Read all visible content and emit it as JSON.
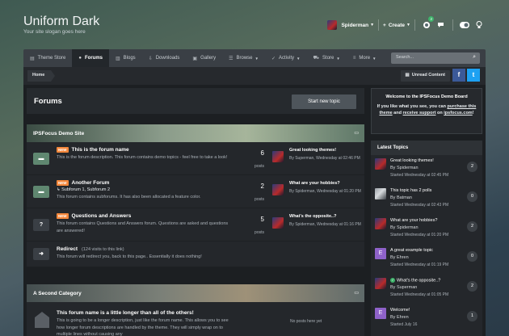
{
  "site": {
    "title": "Uniform Dark",
    "slogan": "Your site slogan goes here"
  },
  "userbar": {
    "username": "Spiderman",
    "create_label": "Create",
    "notifications_count": "2"
  },
  "nav": {
    "items": [
      {
        "label": "Theme Store",
        "icon": "page-icon"
      },
      {
        "label": "Forums",
        "icon": "chat-icon"
      },
      {
        "label": "Blogs",
        "icon": "blog-icon"
      },
      {
        "label": "Downloads",
        "icon": "download-icon"
      },
      {
        "label": "Gallery",
        "icon": "camera-icon"
      },
      {
        "label": "Browse",
        "icon": "list-icon"
      },
      {
        "label": "Activity",
        "icon": "activity-icon"
      },
      {
        "label": "Store",
        "icon": "cart-icon"
      },
      {
        "label": "More",
        "icon": "menu-icon"
      }
    ],
    "search_placeholder": "Search..."
  },
  "breadcrumb": {
    "home": "Home",
    "unread_label": "Unread Content"
  },
  "forums_page": {
    "title": "Forums",
    "start_topic_label": "Start new topic"
  },
  "categories": [
    {
      "name": "IPSFocus Demo Site",
      "forums": [
        {
          "is_new": true,
          "new_label": "NEW",
          "title": "This is the forum name",
          "description": "This is the forum description. This forum contains demo topics - feel free to take a look!",
          "posts": "6",
          "posts_label": "posts",
          "last_title": "Great looking themes!",
          "last_meta": "By Superman, Wednesday at 02:46 PM"
        },
        {
          "is_new": true,
          "new_label": "NEW",
          "title": "Another Forum",
          "subforums": "Subforum 1,  Subforum 2",
          "description": "This forum contains subforums. It has also been allocated a feature color.",
          "posts": "2",
          "posts_label": "posts",
          "last_title": "What are your hobbies?",
          "last_meta": "By Spiderman, Wednesday at 01:20 PM"
        },
        {
          "is_new": true,
          "new_label": "NEW",
          "title": "Questions and Answers",
          "description": "This forum contains Questions and Answers forum. Questions are asked and questions are answered!",
          "posts": "5",
          "posts_label": "posts",
          "last_title": "What's the opposite..?",
          "last_meta": "By Spiderman, Wednesday at 01:16 PM"
        },
        {
          "title": "Redirect",
          "redirect_count": "(124 visits to this link)",
          "description": "This forum will redirect you, back to this page.. Essentially it does nothing!"
        }
      ]
    },
    {
      "name": "A Second Category",
      "forums": [
        {
          "title": "This forum name is a little longer than all of the others!",
          "description": "This is going to be a longer description, just like the forum name. This allows you to see how longer forum descriptions are handled by the theme. They will simply wrap on to multiple lines without causing any",
          "no_posts": "No posts here yet"
        }
      ]
    }
  ],
  "sidebar": {
    "welcome_title": "Welcome to the IPSFocus Demo Board",
    "welcome_text_1": "If you like what you see, you can ",
    "welcome_link_1": "purchase this theme",
    "welcome_text_2": " and ",
    "welcome_link_2": "receive support",
    "welcome_text_3": " on ",
    "welcome_link_3": "ipsfocus.com",
    "welcome_text_4": "!",
    "latest_title": "Latest Topics",
    "topics": [
      {
        "title": "Great looking themes!",
        "by": "By Spiderman",
        "date": "Started Wednesday at 02:45 PM",
        "count": "2",
        "avatar": "spiderman"
      },
      {
        "title": "This topic has 2 polls",
        "by": "By Batman",
        "date": "Started Wednesday at 02:43 PM",
        "count": "0",
        "avatar": "batman"
      },
      {
        "title": "What are your hobbies?",
        "by": "By Spiderman",
        "date": "Started Wednesday at 01:20 PM",
        "count": "2",
        "avatar": "spiderman"
      },
      {
        "title": "A great example topic",
        "by": "By Ehren",
        "date": "Started Wednesday at 01:19 PM",
        "count": "0",
        "avatar": "E"
      },
      {
        "title": "What's the opposite..?",
        "by": "By Superman",
        "date": "Started Wednesday at 01:05 PM",
        "count": "2",
        "avatar": "spiderman",
        "solved": true
      },
      {
        "title": "Welcome!",
        "by": "By Ehren",
        "date": "Started July 16",
        "count": "1",
        "avatar": "E"
      }
    ]
  }
}
